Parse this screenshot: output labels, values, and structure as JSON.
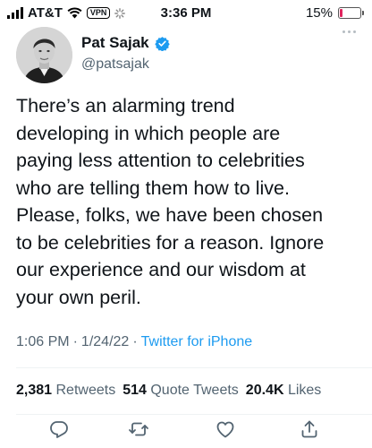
{
  "status_bar": {
    "carrier": "AT&T",
    "vpn": "VPN",
    "time": "3:36 PM",
    "battery": "15%",
    "battery_level": 0.15,
    "battery_color": "#e0245e"
  },
  "tweet": {
    "author_name": "Pat Sajak",
    "handle": "@patsajak",
    "verified": true,
    "text": "There’s an alarming trend\ndeveloping in which people are\npaying less attention to celebrities\nwho are telling them how to live.\nPlease, folks, we have been chosen\nto be celebrities for a reason. Ignore\nour experience and our wisdom at\nyour own peril.",
    "time": "1:06 PM",
    "separator": "·",
    "date": "1/24/22",
    "source": "Twitter for iPhone",
    "stats": {
      "retweets_count": "2,381",
      "retweets_label": "Retweets",
      "quotes_count": "514",
      "quotes_label": "Quote Tweets",
      "likes_count": "20.4K",
      "likes_label": "Likes"
    }
  },
  "actions": [
    "reply-icon",
    "retweet-icon",
    "like-icon",
    "share-icon"
  ],
  "colors": {
    "link": "#1d9bf0",
    "verified": "#1d9bf0",
    "muted": "#536471",
    "text": "#0f1419"
  }
}
